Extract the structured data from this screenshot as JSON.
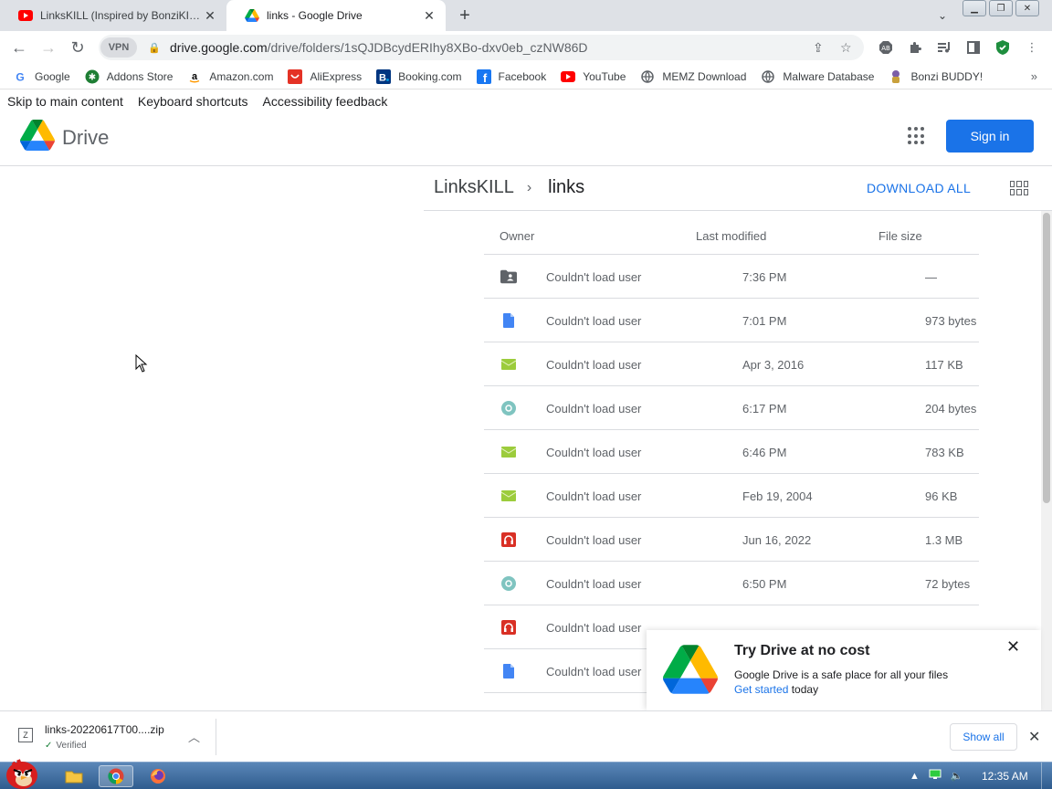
{
  "browser": {
    "tabs": [
      {
        "title": "LinksKILL (Inspired by BonziKILL)",
        "icon": "youtube-icon",
        "active": false
      },
      {
        "title": "links - Google Drive",
        "icon": "google-drive-icon",
        "active": true
      }
    ],
    "new_tab": "+",
    "address": {
      "vpn_label": "VPN",
      "domain": "drive.google.com",
      "path": "/drive/folders/1sQJDBcydERIhy8XBo-dxv0eb_czNW86D"
    },
    "bookmarks": [
      {
        "label": "Google",
        "icon": "google-icon",
        "color": "#4285f4"
      },
      {
        "label": "Addons Store",
        "icon": "addons-store-icon",
        "color": "#1e8e3e"
      },
      {
        "label": "Amazon.com",
        "icon": "amazon-icon",
        "color": "#000000"
      },
      {
        "label": "AliExpress",
        "icon": "aliexpress-icon",
        "color": "#e43225"
      },
      {
        "label": "Booking.com",
        "icon": "booking-icon",
        "color": "#003580"
      },
      {
        "label": "Facebook",
        "icon": "facebook-icon",
        "color": "#1877f2"
      },
      {
        "label": "YouTube",
        "icon": "youtube-icon",
        "color": "#ff0000"
      },
      {
        "label": "MEMZ Download",
        "icon": "globe-icon",
        "color": "#5f6368"
      },
      {
        "label": "Malware Database",
        "icon": "globe-icon",
        "color": "#5f6368"
      },
      {
        "label": "Bonzi BUDDY!",
        "icon": "bonzi-icon",
        "color": "#7b5ea7"
      }
    ],
    "bookmarks_more": "»"
  },
  "page": {
    "skip_links": [
      "Skip to main content",
      "Keyboard shortcuts",
      "Accessibility feedback"
    ],
    "brand": "Drive",
    "sign_in": "Sign in",
    "breadcrumb": {
      "parent": "LinksKILL",
      "separator": "›",
      "current": "links"
    },
    "download_all": "DOWNLOAD ALL",
    "columns": {
      "owner": "Owner",
      "modified": "Last modified",
      "size": "File size"
    },
    "files": [
      {
        "type": "shared-folder",
        "owner": "Couldn't load user",
        "modified": "7:36 PM",
        "size": "—"
      },
      {
        "type": "doc",
        "owner": "Couldn't load user",
        "modified": "7:01 PM",
        "size": "973 bytes"
      },
      {
        "type": "archive",
        "owner": "Couldn't load user",
        "modified": "Apr 3, 2016",
        "size": "117 KB"
      },
      {
        "type": "binary",
        "owner": "Couldn't load user",
        "modified": "6:17 PM",
        "size": "204 bytes"
      },
      {
        "type": "archive",
        "owner": "Couldn't load user",
        "modified": "6:46 PM",
        "size": "783 KB"
      },
      {
        "type": "archive",
        "owner": "Couldn't load user",
        "modified": "Feb 19, 2004",
        "size": "96 KB"
      },
      {
        "type": "audio",
        "owner": "Couldn't load user",
        "modified": "Jun 16, 2022",
        "size": "1.3 MB"
      },
      {
        "type": "binary",
        "owner": "Couldn't load user",
        "modified": "6:50 PM",
        "size": "72 bytes"
      },
      {
        "type": "audio",
        "owner": "Couldn't load user",
        "modified": "",
        "size": ""
      },
      {
        "type": "doc",
        "owner": "Couldn't load user",
        "modified": "",
        "size": ""
      }
    ],
    "promo": {
      "title": "Try Drive at no cost",
      "text": "Google Drive is a safe place for all your files",
      "link": "Get started",
      "after_link": " today"
    }
  },
  "downloads": {
    "filename": "links-20220617T00....zip",
    "status": "Verified",
    "show_all": "Show all"
  },
  "taskbar": {
    "clock": "12:35 AM"
  },
  "colors": {
    "accent": "#1a73e8",
    "archive": "#9ccc3c",
    "binary": "#7fc4c0",
    "audio": "#d93025",
    "doc": "#4285f4"
  }
}
